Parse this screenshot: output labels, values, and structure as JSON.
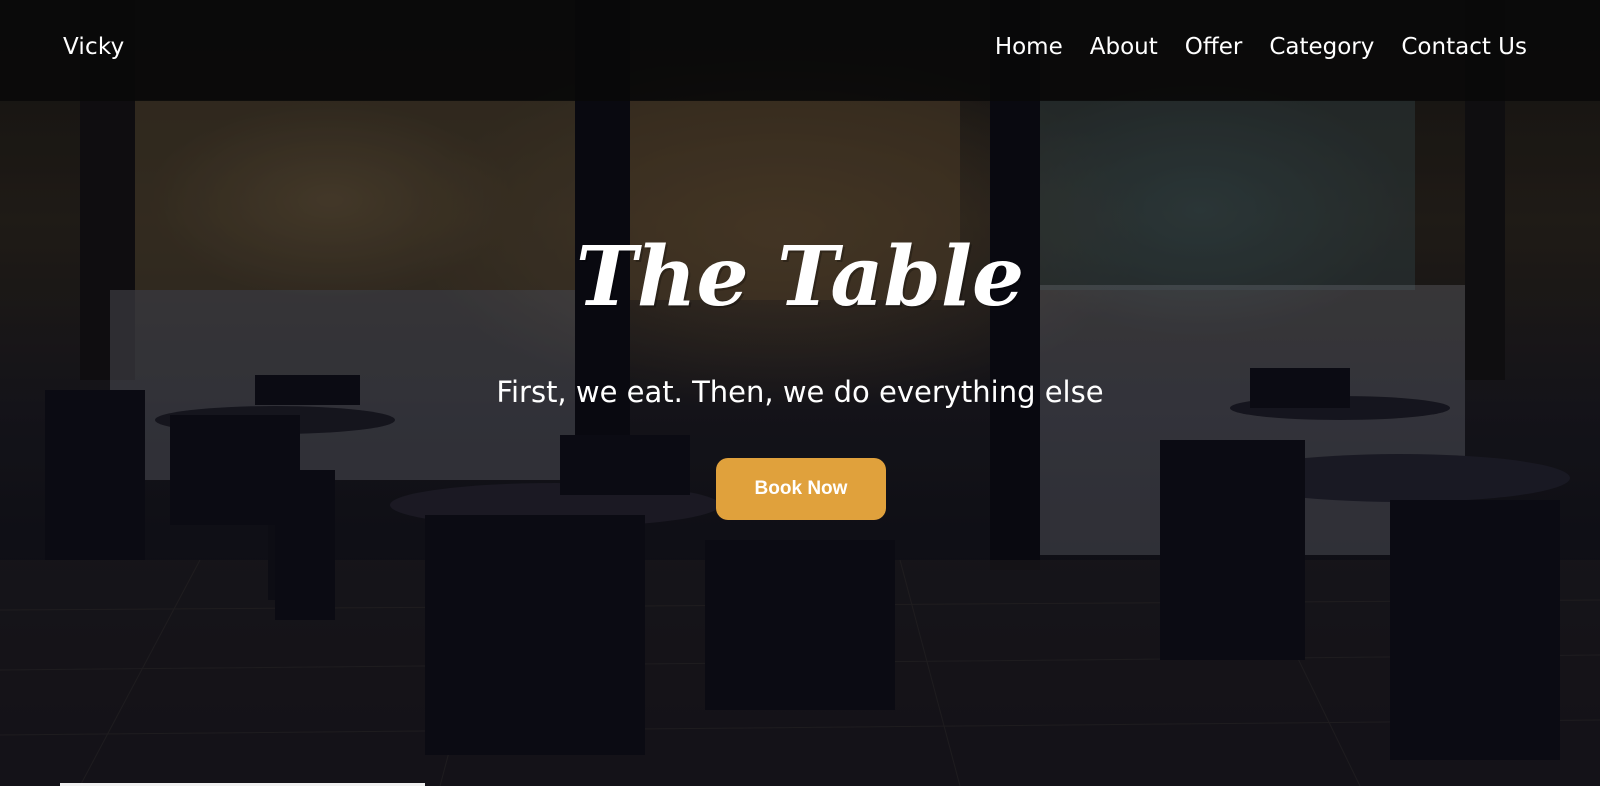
{
  "navbar": {
    "brand": "Vicky",
    "links": [
      {
        "label": "Home"
      },
      {
        "label": "About"
      },
      {
        "label": "Offer"
      },
      {
        "label": "Category"
      },
      {
        "label": "Contact Us"
      }
    ]
  },
  "hero": {
    "title": "The Table",
    "subtitle": "First, we eat. Then, we do everything else",
    "cta_label": "Book Now",
    "background": "restaurant-interior-photo"
  },
  "colors": {
    "navbar_bg": "#080808",
    "accent": "#e0a13c",
    "text": "#ffffff"
  }
}
